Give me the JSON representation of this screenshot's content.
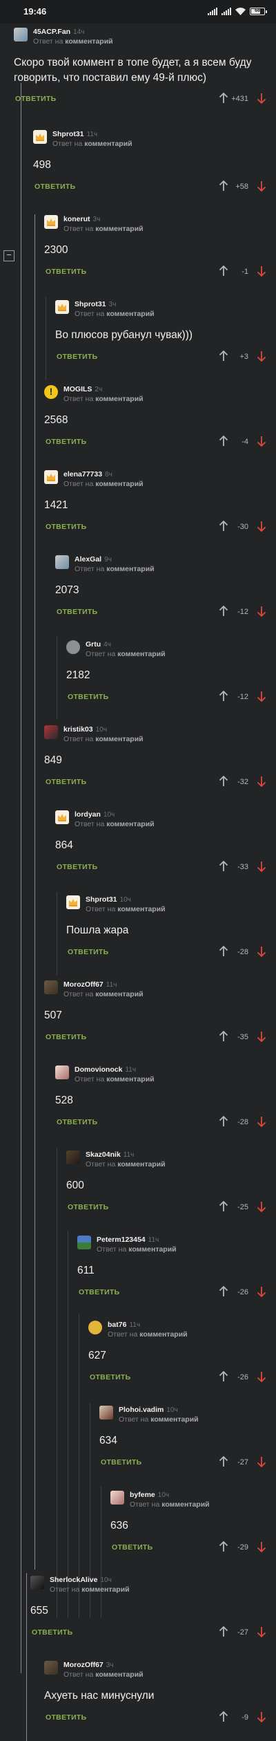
{
  "status": {
    "time": "19:46",
    "battery": "68"
  },
  "labels": {
    "reply_prefix": "Ответ на",
    "reply_target": "комментарий",
    "answer": "ОТВЕТИТЬ"
  },
  "comments": [
    {
      "user": "45ACP.Fan",
      "time": "14ч",
      "text": "Скоро твой коммент в топе будет, а я всем буду говорить, что поставил ему 49-й плюс)",
      "rating": "+431"
    },
    {
      "user": "Shprot31",
      "time": "11ч",
      "text": "498",
      "rating": "+58"
    },
    {
      "user": "konerut",
      "time": "3ч",
      "text": "2300",
      "rating": "-1"
    },
    {
      "user": "Shprot31",
      "time": "3ч",
      "text": "Во плюсов рубанул чувак)))",
      "rating": "+3"
    },
    {
      "user": "MOGILS",
      "time": "2ч",
      "text": "2568",
      "rating": "-4"
    },
    {
      "user": "elena77733",
      "time": "8ч",
      "text": "1421",
      "rating": "-30"
    },
    {
      "user": "AlexGal",
      "time": "9ч",
      "text": "2073",
      "rating": "-12"
    },
    {
      "user": "Grtu",
      "time": "4ч",
      "text": "2182",
      "rating": "-12"
    },
    {
      "user": "kristik03",
      "time": "10ч",
      "text": "849",
      "rating": "-32"
    },
    {
      "user": "lordyan",
      "time": "10ч",
      "text": "864",
      "rating": "-33"
    },
    {
      "user": "Shprot31",
      "time": "10ч",
      "text": "Пошла жара",
      "rating": "-28"
    },
    {
      "user": "MorozOff67",
      "time": "11ч",
      "text": "507",
      "rating": "-35"
    },
    {
      "user": "Domovionock",
      "time": "11ч",
      "text": "528",
      "rating": "-28"
    },
    {
      "user": "Skaz04nik",
      "time": "11ч",
      "text": "600",
      "rating": "-25"
    },
    {
      "user": "Peterm123454",
      "time": "11ч",
      "text": "611",
      "rating": "-26"
    },
    {
      "user": "bat76",
      "time": "11ч",
      "text": "627",
      "rating": "-26"
    },
    {
      "user": "Plohoi.vadim",
      "time": "10ч",
      "text": "634",
      "rating": "-27"
    },
    {
      "user": "byfeme",
      "time": "10ч",
      "text": "636",
      "rating": "-29"
    },
    {
      "user": "SherlockAlive",
      "time": "10ч",
      "text": "655",
      "rating": "-27"
    },
    {
      "user": "MorozOff67",
      "time": "3ч",
      "text": "Ахуеть нас минуснули",
      "rating": "-9"
    }
  ],
  "icons": {
    "upvote": "arrow-up-icon",
    "downvote": "arrow-down-icon",
    "collapse": "collapse-minus-icon"
  },
  "colors": {
    "background": "#232426",
    "answer": "#8ab14e",
    "downvote": "#e0483d",
    "upvote": "#b5b6b9"
  }
}
